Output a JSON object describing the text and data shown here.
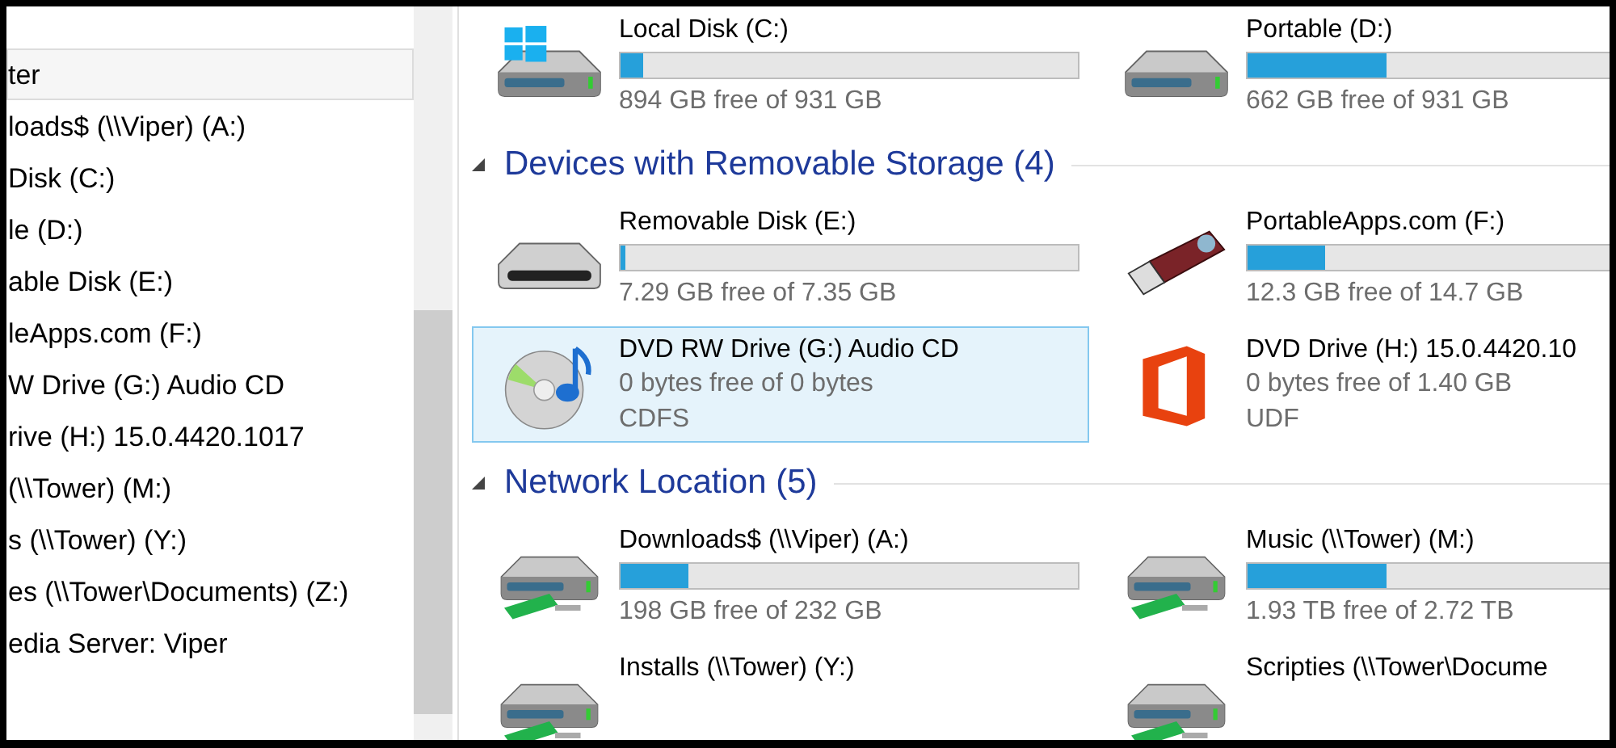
{
  "navigation": {
    "items": [
      {
        "label": "ter",
        "selected": true
      },
      {
        "label": "loads$ (\\\\Viper) (A:)",
        "selected": false
      },
      {
        "label": "Disk (C:)",
        "selected": false
      },
      {
        "label": "le (D:)",
        "selected": false
      },
      {
        "label": "able Disk (E:)",
        "selected": false
      },
      {
        "label": "leApps.com (F:)",
        "selected": false
      },
      {
        "label": "W Drive (G:) Audio CD",
        "selected": false
      },
      {
        "label": "rive (H:) 15.0.4420.1017",
        "selected": false
      },
      {
        "label": "(\\\\Tower) (M:)",
        "selected": false
      },
      {
        "label": "s (\\\\Tower) (Y:)",
        "selected": false
      },
      {
        "label": "es (\\\\Tower\\Documents) (Z:)",
        "selected": false
      },
      {
        "label": "edia Server: Viper",
        "selected": false
      }
    ]
  },
  "sections": [
    {
      "tiles": [
        {
          "kind": "drive",
          "name": "Local Disk (C:)",
          "level": 0.05,
          "free": "894 GB free of 931 GB",
          "selected": false
        },
        {
          "kind": "drive",
          "name": "Portable (D:)",
          "level": 0.29,
          "free": "662 GB free of 931 GB",
          "selected": false
        }
      ]
    },
    {
      "title": "Devices with Removable Storage (4)",
      "expanded": true,
      "tiles": [
        {
          "kind": "drive",
          "name": "Removable Disk (E:)",
          "level": 0.01,
          "free": "7.29 GB free of 7.35 GB",
          "selected": false
        },
        {
          "kind": "drive",
          "name": "PortableApps.com (F:)",
          "level": 0.16,
          "free": "12.3 GB free of 14.7 GB",
          "selected": false
        },
        {
          "kind": "optical",
          "name": "DVD RW Drive (G:) Audio CD",
          "free": "0 bytes free of 0 bytes",
          "file_system": "CDFS",
          "selected": true
        },
        {
          "kind": "optical",
          "name": "DVD Drive (H:) 15.0.4420.10",
          "free": "0 bytes free of 1.40 GB",
          "file_system": "UDF",
          "selected": false
        }
      ]
    },
    {
      "title": "Network Location (5)",
      "expanded": true,
      "tiles": [
        {
          "kind": "drive",
          "name": "Downloads$ (\\\\Viper) (A:)",
          "level": 0.15,
          "free": "198 GB free of 232 GB",
          "selected": false
        },
        {
          "kind": "drive",
          "name": "Music (\\\\Tower) (M:)",
          "level": 0.29,
          "free": "1.93 TB free of 2.72 TB",
          "selected": false
        },
        {
          "kind": "drive",
          "name": "Installs (\\\\Tower) (Y:)",
          "selected": false
        },
        {
          "kind": "drive",
          "name": "Scripties (\\\\Tower\\Docume",
          "selected": false
        }
      ]
    }
  ]
}
